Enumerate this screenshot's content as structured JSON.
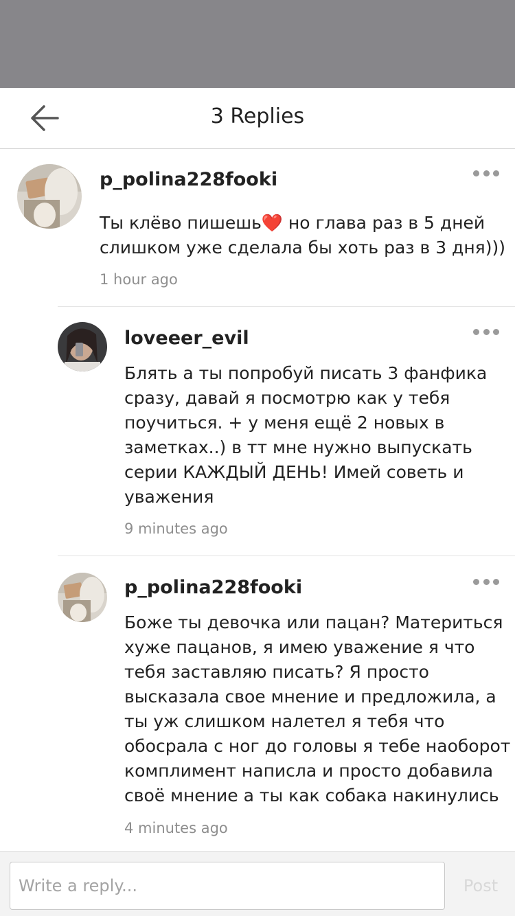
{
  "header": {
    "title": "3 Replies",
    "back_icon": "arrow-left-icon"
  },
  "comments": [
    {
      "username": "p_polina228fooki",
      "text_lines": [
        "Ты клёво пишешь❤️ но глава раз в 5 дней",
        "слишком уже сделала бы хоть раз в 3  дня)))"
      ],
      "time": "1 hour ago"
    },
    {
      "username": "loveeer_evil",
      "text_lines": [
        "Блять а ты попробуй писать 3 фанфика",
        "сразу, давай я посмотрю как у тебя",
        "поучиться. + у меня ещё 2 новых в",
        "заметках..) в тт мне нужно выпускать",
        "серии КАЖДЫЙ ДЕНЬ! Имей советь и",
        "уважения"
      ],
      "time": "9 minutes ago"
    },
    {
      "username": "p_polina228fooki",
      "text_lines": [
        "Боже ты девочка или пацан? Материться",
        "хуже пацанов, я имею уважение я что",
        "тебя заставляю писать? Я просто",
        "высказала свое мнение и предложила, а",
        "ты уж слишком налетел я тебя что",
        "обосрала с ног до головы я тебе наоборот",
        "комплимент написла и просто добавила",
        "своё мнение а ты как собака накинулись"
      ],
      "time": "4 minutes ago"
    }
  ],
  "footer": {
    "reply_placeholder": "Write a reply...",
    "post_label": "Post"
  },
  "colors": {
    "status_bar": "#87868a",
    "text": "#222222",
    "muted": "#8e8e8e",
    "dots": "#9a9a9a",
    "post_disabled": "#d8d8d8"
  }
}
